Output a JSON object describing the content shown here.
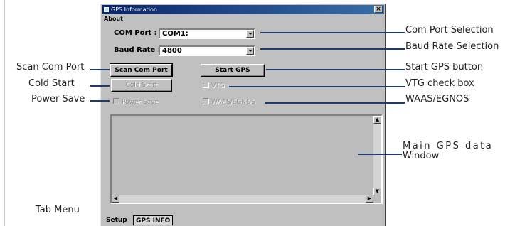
{
  "window": {
    "title": "GPS Information",
    "close_glyph": "×",
    "menu_about": "About"
  },
  "form": {
    "com_port_label": "COM Port :",
    "com_port_value": "COM1:",
    "baud_rate_label": "Baud Rate :",
    "baud_rate_value": "4800"
  },
  "buttons": {
    "scan_com_port": "Scan Com Port",
    "start_gps": "Start GPS",
    "cold_start": "Cold Start"
  },
  "checkboxes": {
    "vtg": "VTG",
    "power_save": "Power Save",
    "waas_egnos": "WAAS/EGNOS"
  },
  "scroll": {
    "up": "▲",
    "down": "▼",
    "left": "◀",
    "right": "▶"
  },
  "tabs": [
    {
      "label": "Setup"
    },
    {
      "label": "GPS INFO"
    }
  ],
  "annotations": {
    "com_port_selection": "Com Port Selection",
    "baud_rate_selection": "Baud Rate Selection",
    "start_gps_button": "Start GPS button",
    "vtg_check_box": "VTG check box",
    "waas_egnos": "WAAS/EGNOS",
    "main_gps_line1": "Main GPS data",
    "main_gps_line2": "Window",
    "scan_com_port": "Scan Com Port",
    "cold_start": "Cold Start",
    "power_save": "Power Save",
    "tab_menu": "Tab Menu"
  }
}
